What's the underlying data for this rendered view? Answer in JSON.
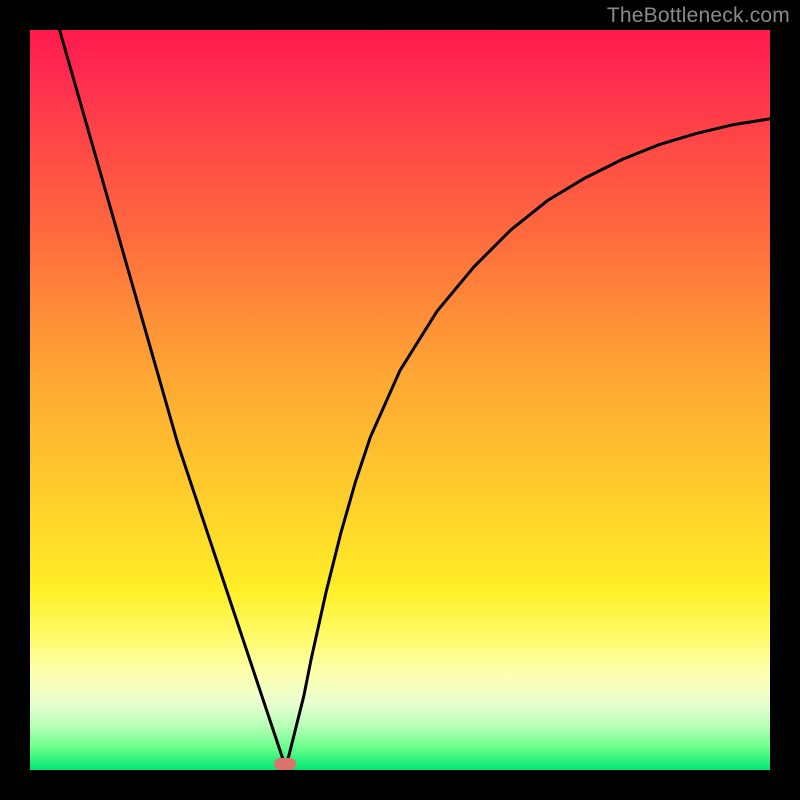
{
  "watermark": "TheBottleneck.com",
  "marker": {
    "color": "#d9736b",
    "x_pct": 34.5,
    "y_pct": 99.2
  },
  "chart_data": {
    "type": "line",
    "title": "",
    "xlabel": "",
    "ylabel": "",
    "xlim": [
      0,
      100
    ],
    "ylim": [
      0,
      100
    ],
    "grid": false,
    "legend": false,
    "background_gradient": {
      "orientation": "vertical",
      "stops": [
        {
          "pos": 0,
          "color": "#ff1a4a"
        },
        {
          "pos": 50,
          "color": "#ffc22e"
        },
        {
          "pos": 80,
          "color": "#ffff80"
        },
        {
          "pos": 100,
          "color": "#00e676"
        }
      ]
    },
    "series": [
      {
        "name": "bottleneck-curve",
        "color": "#000000",
        "x": [
          4,
          6,
          8,
          10,
          12,
          14,
          16,
          18,
          20,
          22,
          24,
          26,
          28,
          30,
          31,
          32,
          33,
          34,
          34.5,
          35,
          36,
          37,
          38,
          40,
          42,
          44,
          46,
          50,
          55,
          60,
          65,
          70,
          75,
          80,
          85,
          90,
          95,
          100
        ],
        "y": [
          100,
          93,
          86,
          79,
          72,
          65,
          58,
          51,
          44,
          38,
          32,
          26,
          20,
          14,
          11,
          8,
          5,
          2,
          0.5,
          2,
          6,
          10,
          15,
          24,
          32,
          39,
          45,
          54,
          62,
          68,
          73,
          77,
          80,
          82.5,
          84.5,
          86,
          87.2,
          88
        ]
      }
    ],
    "annotations": [
      {
        "type": "marker",
        "x": 34.5,
        "y": 0.8,
        "shape": "rounded-pill",
        "color": "#d9736b"
      }
    ]
  }
}
